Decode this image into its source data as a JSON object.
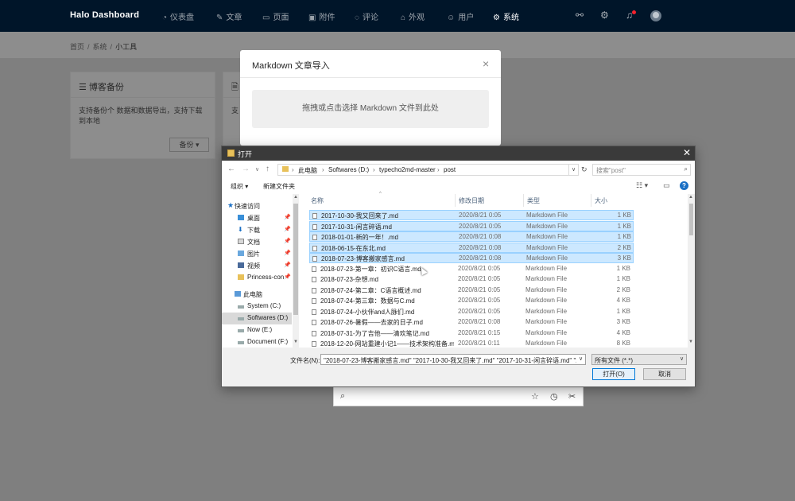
{
  "topnav": {
    "brand": "Halo  Dashboard",
    "items": [
      {
        "icon": "◔",
        "label": "仪表盘",
        "active": false
      },
      {
        "icon": "✎",
        "label": "文章",
        "active": false
      },
      {
        "icon": "▭",
        "label": "页面",
        "active": false
      },
      {
        "icon": "▣",
        "label": "附件",
        "active": false
      },
      {
        "icon": "◌",
        "label": "评论",
        "active": false
      },
      {
        "icon": "⌂",
        "label": "外观",
        "active": false
      },
      {
        "icon": "☺",
        "label": "用户",
        "active": false
      },
      {
        "icon": "⚙",
        "label": "系统",
        "active": true
      }
    ],
    "right_icons": [
      "link-icon",
      "settings-icon",
      "bell-icon",
      "avatar"
    ]
  },
  "breadcrumb": {
    "items": [
      "首页",
      "系统",
      "小工具"
    ],
    "separator": "/"
  },
  "cards": {
    "backup": {
      "title": "博客备份",
      "desc": "支持备份个 数据和数据导出，支持下载到本地",
      "button": "备份"
    },
    "import": {
      "title": "",
      "desc": "支"
    }
  },
  "md_modal": {
    "title": "Markdown 文章导入",
    "close": "×",
    "dropzone": "拖拽或点击选择 Markdown 文件到此处"
  },
  "open_dialog": {
    "title": "打开",
    "close": "✕",
    "address": [
      "此电脑",
      "Softwares (D:)",
      "typecho2md-master",
      "post"
    ],
    "search_placeholder": "搜索\"post\"",
    "toolbar": {
      "organize": "组织 ▾",
      "new_folder": "新建文件夹"
    },
    "nav": [
      {
        "label": "快速访问",
        "icon": "star",
        "pinned": false,
        "selected": false
      },
      {
        "label": "桌面",
        "icon": "desktop",
        "pinned": true,
        "selected": false
      },
      {
        "label": "下载",
        "icon": "download",
        "pinned": true,
        "selected": false
      },
      {
        "label": "文档",
        "icon": "document",
        "pinned": true,
        "selected": false
      },
      {
        "label": "图片",
        "icon": "picture",
        "pinned": true,
        "selected": false
      },
      {
        "label": "视频",
        "icon": "video",
        "pinned": true,
        "selected": false
      },
      {
        "label": "Princess-con",
        "icon": "folder",
        "pinned": true,
        "selected": false
      },
      {
        "label": "此电脑",
        "icon": "computer",
        "pinned": false,
        "selected": false
      },
      {
        "label": "System (C:)",
        "icon": "drive",
        "pinned": false,
        "selected": false
      },
      {
        "label": "Softwares (D:)",
        "icon": "drive",
        "pinned": false,
        "selected": true
      },
      {
        "label": "Now (E:)",
        "icon": "drive",
        "pinned": false,
        "selected": false
      },
      {
        "label": "Document (F:)",
        "icon": "drive",
        "pinned": false,
        "selected": false
      }
    ],
    "columns": [
      "名称",
      "修改日期",
      "类型",
      "大小"
    ],
    "files": [
      {
        "name": "2017-10-30-我又回来了.md",
        "date": "2020/8/21 0:05",
        "type": "Markdown File",
        "size": "1 KB",
        "selected": true
      },
      {
        "name": "2017-10-31-闲言碎语.md",
        "date": "2020/8/21 0:05",
        "type": "Markdown File",
        "size": "1 KB",
        "selected": true
      },
      {
        "name": "2018-01-01-新的一年！.md",
        "date": "2020/8/21 0:08",
        "type": "Markdown File",
        "size": "1 KB",
        "selected": true
      },
      {
        "name": "2018-06-15-在东北.md",
        "date": "2020/8/21 0:08",
        "type": "Markdown File",
        "size": "2 KB",
        "selected": true
      },
      {
        "name": "2018-07-23-博客搬家感言.md",
        "date": "2020/8/21 0:08",
        "type": "Markdown File",
        "size": "3 KB",
        "selected": true
      },
      {
        "name": "2018-07-23-第一章：初识C语言.md",
        "date": "2020/8/21 0:05",
        "type": "Markdown File",
        "size": "1 KB",
        "selected": false
      },
      {
        "name": "2018-07-23-杂想.md",
        "date": "2020/8/21 0:05",
        "type": "Markdown File",
        "size": "1 KB",
        "selected": false
      },
      {
        "name": "2018-07-24-第二章：C语言概述.md",
        "date": "2020/8/21 0:05",
        "type": "Markdown File",
        "size": "2 KB",
        "selected": false
      },
      {
        "name": "2018-07-24-第三章：数据与C.md",
        "date": "2020/8/21 0:05",
        "type": "Markdown File",
        "size": "4 KB",
        "selected": false
      },
      {
        "name": "2018-07-24-小伙伴and人脉们.md",
        "date": "2020/8/21 0:05",
        "type": "Markdown File",
        "size": "1 KB",
        "selected": false
      },
      {
        "name": "2018-07-26-暑假——去家的日子.md",
        "date": "2020/8/21 0:08",
        "type": "Markdown File",
        "size": "3 KB",
        "selected": false
      },
      {
        "name": "2018-07-31-为了吉他——清欢笔记.md",
        "date": "2020/8/21 0:15",
        "type": "Markdown File",
        "size": "4 KB",
        "selected": false
      },
      {
        "name": "2018-12-20-网站重建小记1——技术架构准备.md",
        "date": "2020/8/21 0:11",
        "type": "Markdown File",
        "size": "8 KB",
        "selected": false
      }
    ],
    "filename_label": "文件名(N):",
    "filename_value": "\"2018-07-23-博客搬家感言.md\" \"2017-10-30-我又回来了.md\" \"2017-10-31-闲言碎语.md\" \"2018-01-01-新的一年！.md\"",
    "filter_value": "所有文件 (*.*)",
    "open_button": "打开(O)",
    "cancel_button": "取消"
  },
  "browser_bar": {
    "icons": [
      "zoom-icon",
      "star-icon",
      "history-icon",
      "tools-icon"
    ]
  }
}
